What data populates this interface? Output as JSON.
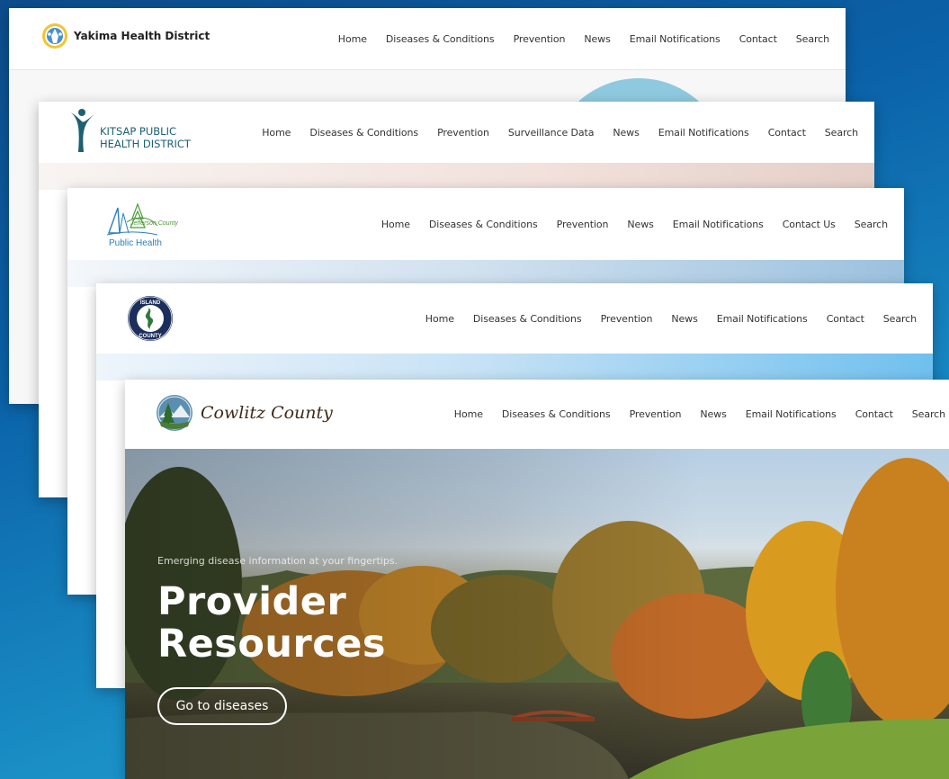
{
  "yakima": {
    "org_name": "Yakima Health District",
    "nav": [
      "Home",
      "Diseases & Conditions",
      "Prevention",
      "News",
      "Email Notifications",
      "Contact",
      "Search"
    ]
  },
  "kitsap": {
    "org_line1": "KITSAP PUBLIC",
    "org_line2": "HEALTH DISTRICT",
    "nav": [
      "Home",
      "Diseases & Conditions",
      "Prevention",
      "Surveillance Data",
      "News",
      "Email Notifications",
      "Contact",
      "Search"
    ]
  },
  "jefferson": {
    "org_line1": "Jefferson County",
    "org_line2": "Public Health",
    "nav": [
      "Home",
      "Diseases & Conditions",
      "Prevention",
      "News",
      "Email Notifications",
      "Contact Us",
      "Search"
    ]
  },
  "island": {
    "seal_top": "ISLAND",
    "seal_bottom": "COUNTY",
    "nav": [
      "Home",
      "Diseases & Conditions",
      "Prevention",
      "News",
      "Email Notifications",
      "Contact",
      "Search"
    ]
  },
  "cowlitz": {
    "org_name": "Cowlitz County",
    "nav": [
      "Home",
      "Diseases & Conditions",
      "Prevention",
      "News",
      "Email Notifications",
      "Contact",
      "Search"
    ],
    "hero": {
      "tagline": "Emerging disease information at your fingertips.",
      "title_line1": "Provider",
      "title_line2": "Resources",
      "cta_label": "Go to diseases"
    }
  },
  "colors": {
    "background_dark": "#0d4d8c",
    "background_light": "#1ba2d6",
    "kitsap_teal": "#1d5f73",
    "jefferson_blue": "#2a7fc0"
  }
}
